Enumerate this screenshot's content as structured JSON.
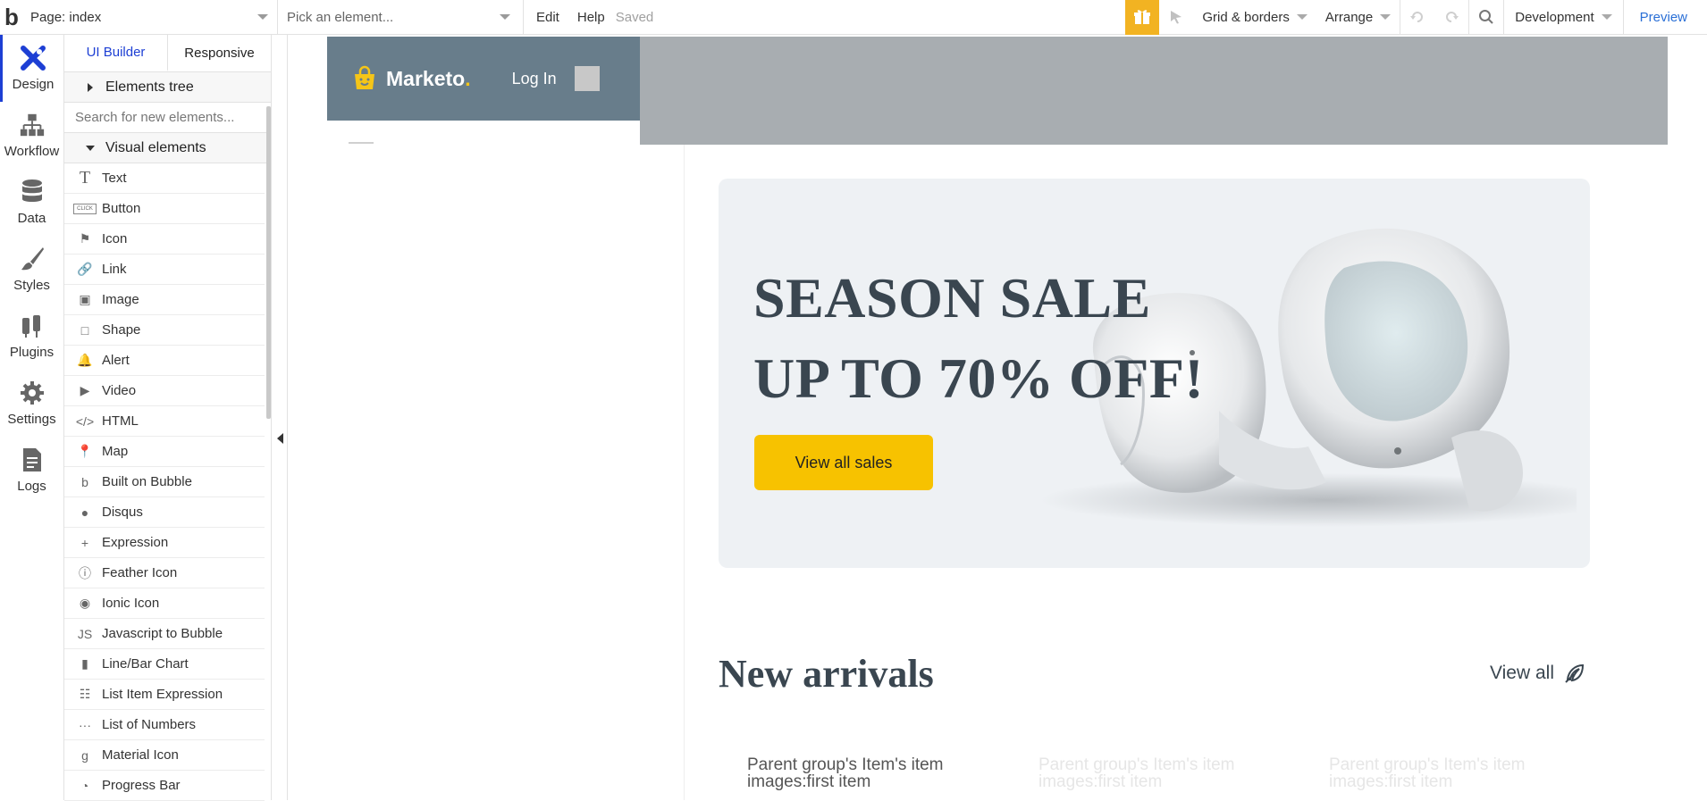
{
  "topbar": {
    "page_label": "Page: index",
    "element_picker_placeholder": "Pick an element...",
    "menu": [
      "Edit",
      "Help"
    ],
    "status": "Saved",
    "grid_label": "Grid & borders",
    "arrange_label": "Arrange",
    "env_label": "Development",
    "preview_label": "Preview"
  },
  "leftnav": {
    "items": [
      {
        "label": "Design",
        "icon": "design-icon"
      },
      {
        "label": "Workflow",
        "icon": "workflow-icon"
      },
      {
        "label": "Data",
        "icon": "database-icon"
      },
      {
        "label": "Styles",
        "icon": "brush-icon"
      },
      {
        "label": "Plugins",
        "icon": "plug-icon"
      },
      {
        "label": "Settings",
        "icon": "gear-icon"
      },
      {
        "label": "Logs",
        "icon": "logs-icon"
      }
    ]
  },
  "panel": {
    "tabs": [
      "UI Builder",
      "Responsive"
    ],
    "elements_tree": "Elements tree",
    "search_placeholder": "Search for new elements...",
    "visual_elements": "Visual elements",
    "items": [
      {
        "label": "Text",
        "icon": "T"
      },
      {
        "label": "Button",
        "icon": "CLICK"
      },
      {
        "label": "Icon",
        "icon": "⚑"
      },
      {
        "label": "Link",
        "icon": "🔗"
      },
      {
        "label": "Image",
        "icon": "▣"
      },
      {
        "label": "Shape",
        "icon": "□"
      },
      {
        "label": "Alert",
        "icon": "🔔"
      },
      {
        "label": "Video",
        "icon": "▶"
      },
      {
        "label": "HTML",
        "icon": "</>"
      },
      {
        "label": "Map",
        "icon": "📍"
      },
      {
        "label": "Built on Bubble",
        "icon": "b"
      },
      {
        "label": "Disqus",
        "icon": "●"
      },
      {
        "label": "Expression",
        "icon": "+"
      },
      {
        "label": "Feather Icon",
        "icon": "ⓘ"
      },
      {
        "label": "Ionic Icon",
        "icon": "◉"
      },
      {
        "label": "Javascript to Bubble",
        "icon": "JS"
      },
      {
        "label": "Line/Bar Chart",
        "icon": "▮"
      },
      {
        "label": "List Item Expression",
        "icon": "☷"
      },
      {
        "label": "List of Numbers",
        "icon": "···"
      },
      {
        "label": "Material Icon",
        "icon": "g"
      },
      {
        "label": "Progress Bar",
        "icon": "◔"
      }
    ]
  },
  "canvas": {
    "brand": "Marketo",
    "brand_dot": ".",
    "login": "Log In",
    "hero_line1": "SEASON SALE",
    "hero_line2": "UP TO 70% OFF!",
    "hero_button": "View all sales",
    "section_title": "New arrivals",
    "view_all": "View all",
    "item_texts": [
      "Parent group's Item's item  images:first item",
      "Parent group's Item's item  images:first item",
      "Parent group's Item's item  images:first item"
    ]
  },
  "colors": {
    "accent": "#1d3fd4",
    "header": "#687d8b",
    "sale_button": "#f7c200",
    "gift": "#f2b322"
  }
}
